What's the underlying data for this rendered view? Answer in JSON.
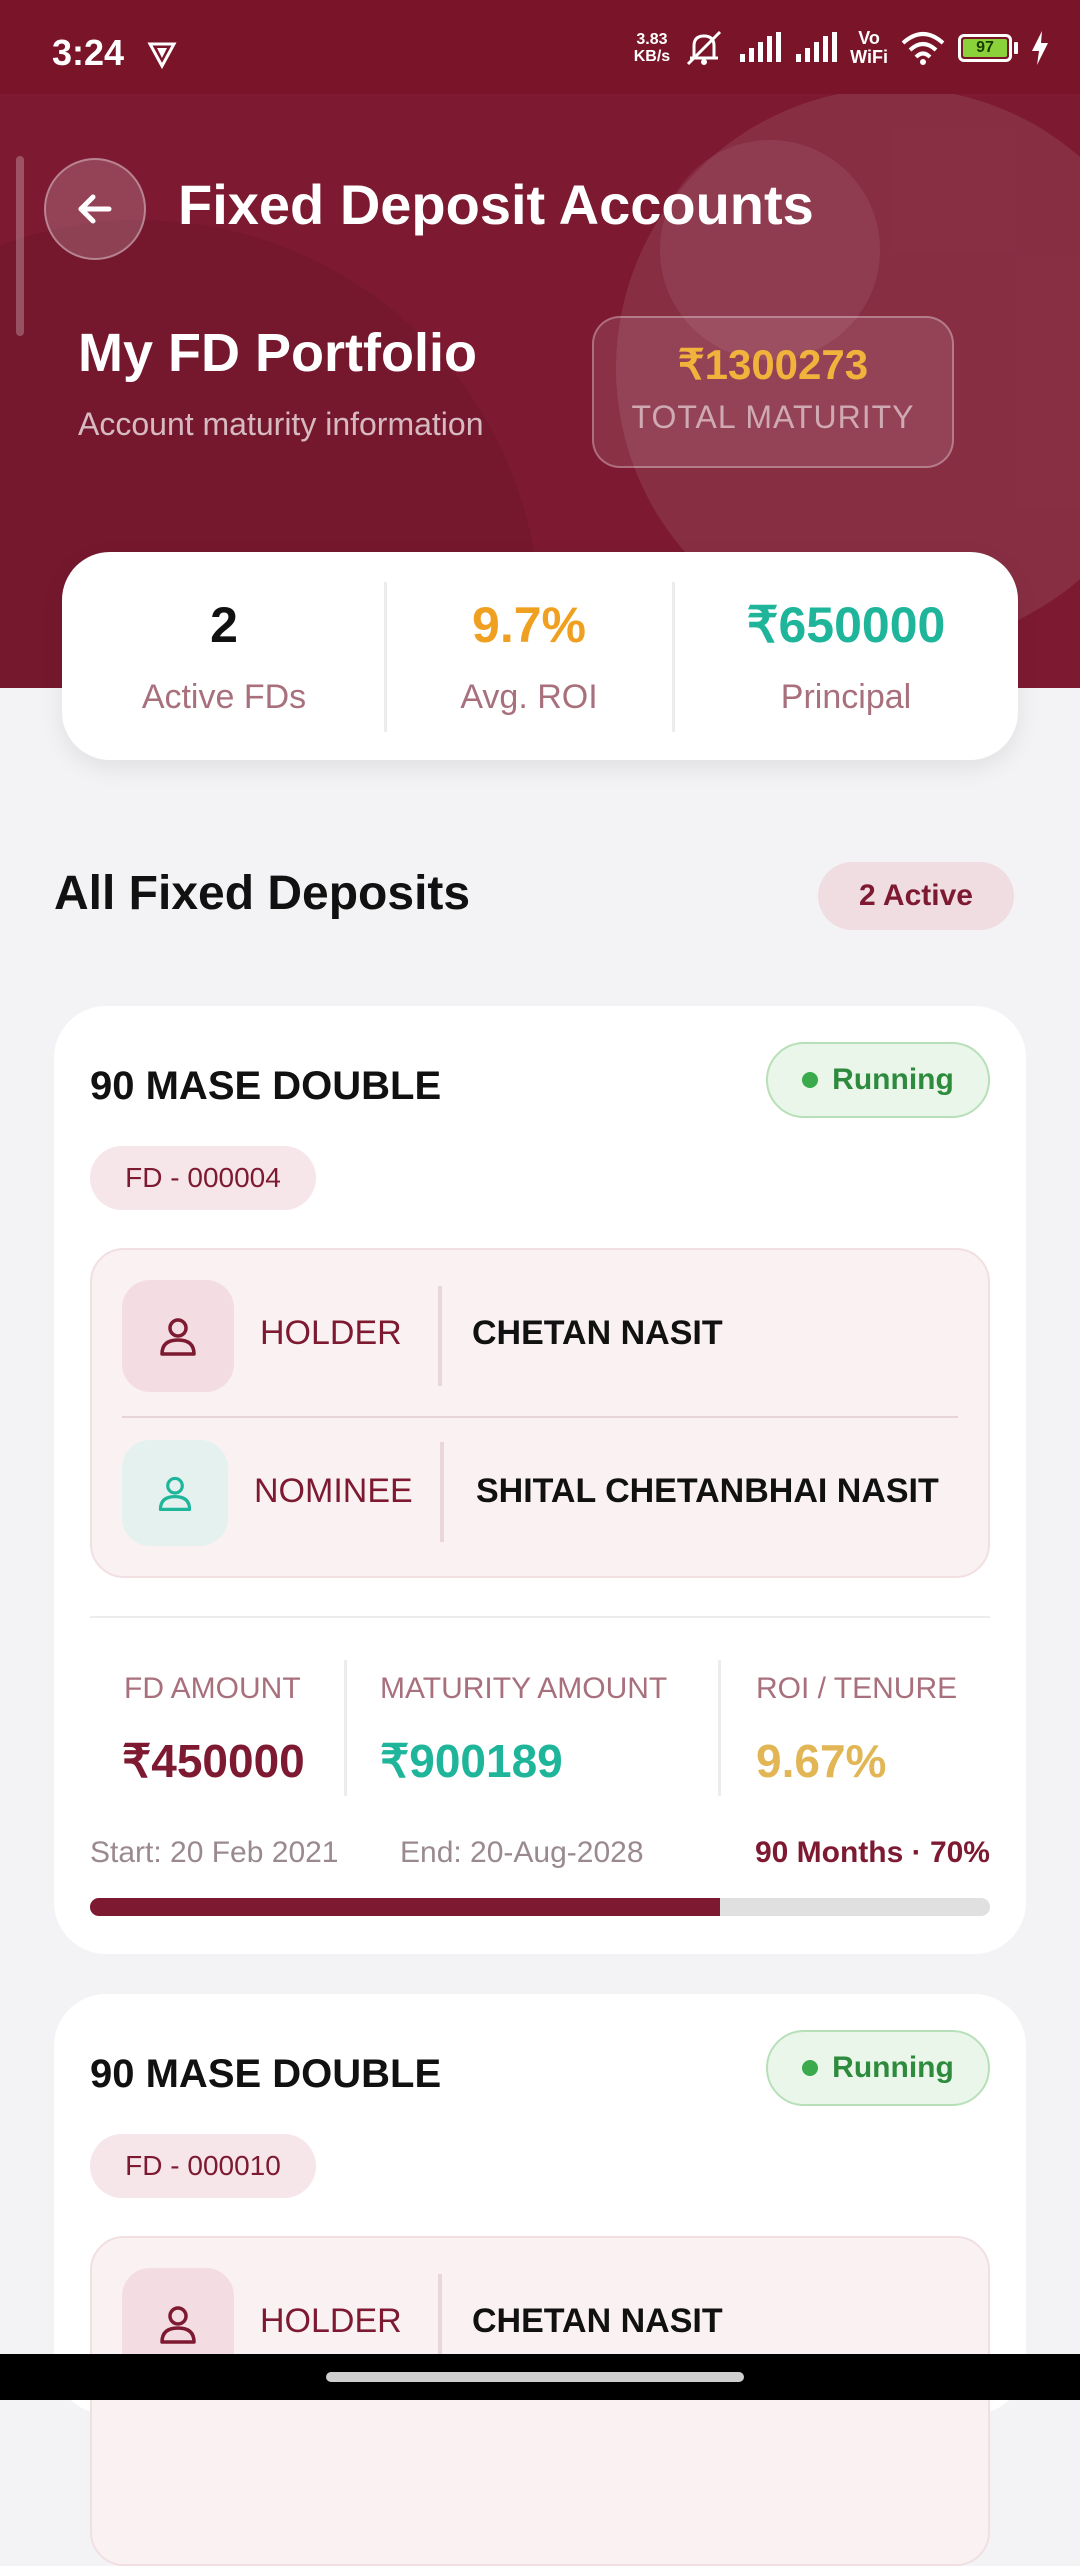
{
  "status_bar": {
    "time": "3:24",
    "net_speed_value": "3.83",
    "net_speed_unit": "KB/s",
    "volte_top": "Vo",
    "volte_bottom": "WiFi",
    "battery": "97"
  },
  "header": {
    "title": "Fixed Deposit Accounts",
    "portfolio_title": "My FD Portfolio",
    "portfolio_subtitle": "Account maturity information",
    "total_maturity_value": "₹1300273",
    "total_maturity_label": "TOTAL MATURITY"
  },
  "stats": {
    "active_count": "2",
    "active_label": "Active FDs",
    "avg_roi": "9.7%",
    "avg_roi_label": "Avg. ROI",
    "principal": "₹650000",
    "principal_label": "Principal"
  },
  "section": {
    "title": "All Fixed Deposits",
    "active_badge": "2 Active"
  },
  "deposits": [
    {
      "name": "90 MASE DOUBLE",
      "status": "Running",
      "id": "FD - 000004",
      "holder_label": "HOLDER",
      "holder_name": "CHETAN NASIT",
      "nominee_label": "NOMINEE",
      "nominee_name": "SHITAL CHETANBHAI NASIT",
      "amount_label": "FD AMOUNT",
      "amount": "₹450000",
      "maturity_label": "MATURITY AMOUNT",
      "maturity": "₹900189",
      "roi_label": "ROI / TENURE",
      "roi": "9.67%",
      "start": "Start: 20 Feb 2021",
      "end": "End: 20-Aug-2028",
      "tenure": "90 Months · 70%",
      "progress": 0.7
    },
    {
      "name": "90 MASE DOUBLE",
      "status": "Running",
      "id": "FD - 000010",
      "holder_label": "HOLDER",
      "holder_name": "CHETAN NASIT"
    }
  ],
  "colors": {
    "primary": "#7d1a31",
    "gold": "#f2b33d",
    "teal": "#1fb59a",
    "green": "#2e8b3e"
  }
}
